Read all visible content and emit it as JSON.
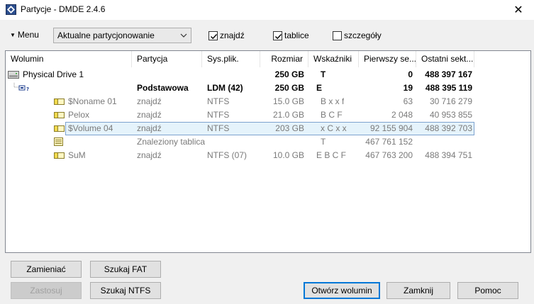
{
  "window": {
    "title": "Partycje - DMDE 2.4.6",
    "close_label": "✕"
  },
  "toolbar": {
    "menu_label": "Menu",
    "mode_select": {
      "value": "Aktualne partycjonowanie"
    },
    "checkboxes": [
      {
        "label": "znajdź",
        "checked": true
      },
      {
        "label": "tablice",
        "checked": true
      },
      {
        "label": "szczegóły",
        "checked": false
      }
    ]
  },
  "list": {
    "columns": [
      "Wolumin",
      "Partycja",
      "Sys.plik.",
      "Rozmiar",
      "Wskaźniki",
      "Pierwszy se...",
      "Ostatni sekt..."
    ],
    "rows": [
      {
        "name": "Physical Drive 1",
        "partition": "",
        "fs": "",
        "size": "250 GB",
        "flags": "T",
        "first": "0",
        "last": "488 397 167",
        "icon": "drive-icon",
        "style": "bold"
      },
      {
        "name": "",
        "partition": "Podstawowa",
        "fs": "LDM (42)",
        "size": "250 GB",
        "flags": "E",
        "first": "19",
        "last": "488 395 119",
        "icon": "partition-tree-icon",
        "style": "bold"
      },
      {
        "name": "$Noname 01",
        "partition": "znajdź",
        "fs": "NTFS",
        "size": "15.0 GB",
        "flags": "B x x f",
        "first": "63",
        "last": "30 716 279",
        "icon": "volume-icon",
        "style": "grey"
      },
      {
        "name": "Pelox",
        "partition": "znajdź",
        "fs": "NTFS",
        "size": "21.0 GB",
        "flags": "B C F",
        "first": "2 048",
        "last": "40 953 855",
        "icon": "volume-icon",
        "style": "grey"
      },
      {
        "name": "$Volume 04",
        "partition": "znajdź",
        "fs": "NTFS",
        "size": "203 GB",
        "flags": "x C x x",
        "first": "92 155 904",
        "last": "488 392 703",
        "icon": "volume-icon",
        "style": "grey-selected"
      },
      {
        "name": "",
        "partition": "Znaleziony tablica",
        "fs": "",
        "size": "",
        "flags": "T",
        "first": "467 761 152",
        "last": "",
        "icon": "table-icon",
        "style": "grey"
      },
      {
        "name": "SuM",
        "partition": "znajdź",
        "fs": "NTFS (07)",
        "size": "10.0 GB",
        "flags": "E B C F",
        "first": "467 763 200",
        "last": "488 394 751",
        "icon": "volume-icon",
        "style": "grey"
      }
    ]
  },
  "buttons": {
    "zamieniac": "Zamieniać",
    "szukaj_fat": "Szukaj FAT",
    "zastosuj": "Zastosuj",
    "szukaj_ntfs": "Szukaj NTFS",
    "otworz": "Otwórz wolumin",
    "zamknij": "Zamknij",
    "pomoc": "Pomoc"
  }
}
